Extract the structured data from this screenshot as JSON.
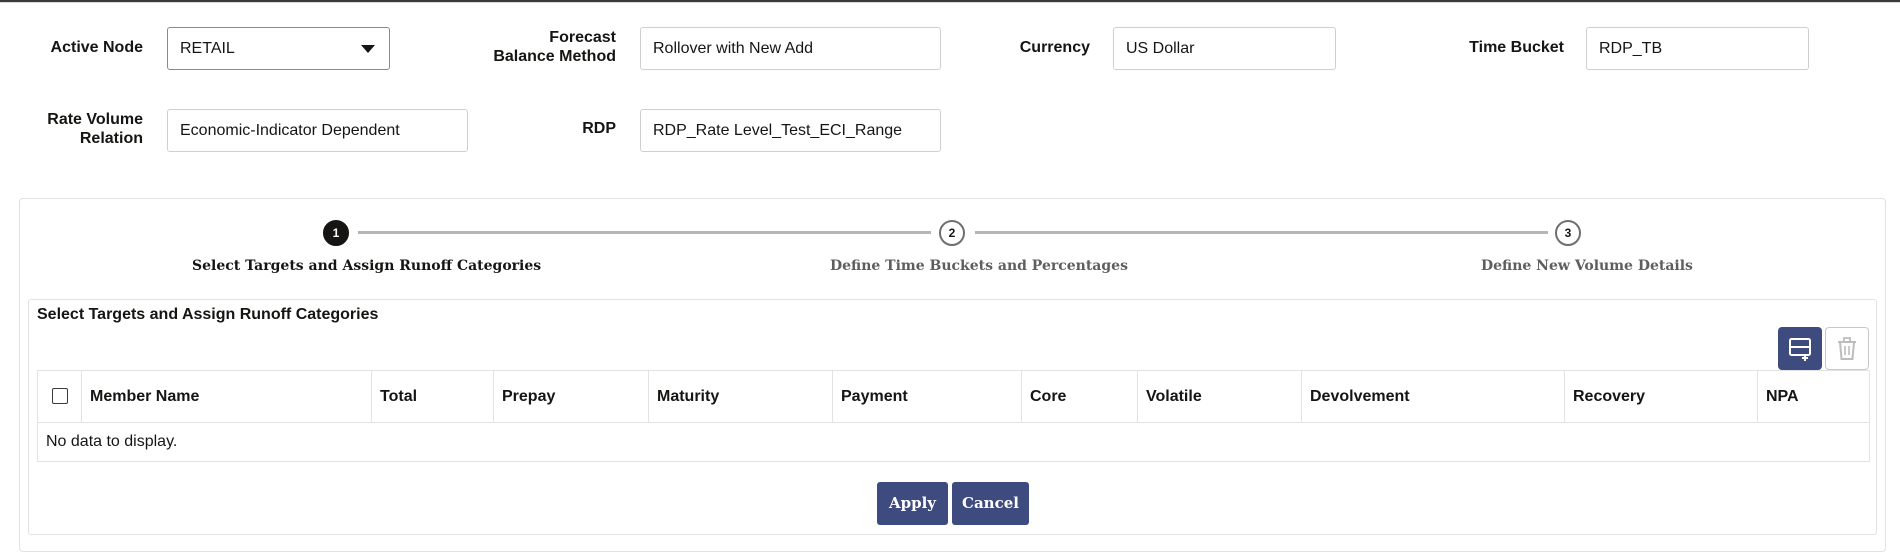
{
  "form": {
    "active_node": {
      "label": "Active Node",
      "value": "RETAIL"
    },
    "forecast_balance_method": {
      "label_line1": "Forecast",
      "label_line2": "Balance Method",
      "value": "Rollover with New Add"
    },
    "currency": {
      "label": "Currency",
      "value": "US Dollar"
    },
    "time_bucket": {
      "label": "Time Bucket",
      "value": "RDP_TB"
    },
    "rate_volume_relation": {
      "label_line1": "Rate Volume",
      "label_line2": "Relation",
      "value": "Economic-Indicator Dependent"
    },
    "rdp": {
      "label": "RDP",
      "value": "RDP_Rate Level_Test_ECI_Range"
    }
  },
  "train": {
    "steps": [
      {
        "number": "1",
        "label": "Select Targets and Assign Runoff Categories",
        "state": "active"
      },
      {
        "number": "2",
        "label": "Define Time Buckets and Percentages",
        "state": "idle"
      },
      {
        "number": "3",
        "label": "Define New Volume Details",
        "state": "idle"
      }
    ]
  },
  "section": {
    "title": "Select Targets and Assign Runoff Categories"
  },
  "toolbar": {
    "add_icon": "add-row-icon",
    "delete_icon": "trash-icon"
  },
  "table": {
    "columns": [
      "Member Name",
      "Total",
      "Prepay",
      "Maturity",
      "Payment",
      "Core",
      "Volatile",
      "Devolvement",
      "Recovery",
      "NPA"
    ],
    "empty_text": "No data to display."
  },
  "actions": {
    "apply_label": "Apply",
    "cancel_label": "Cancel"
  },
  "colors": {
    "primary": "#3e4b7e",
    "text": "#161513",
    "border": "#e2e2e2"
  }
}
